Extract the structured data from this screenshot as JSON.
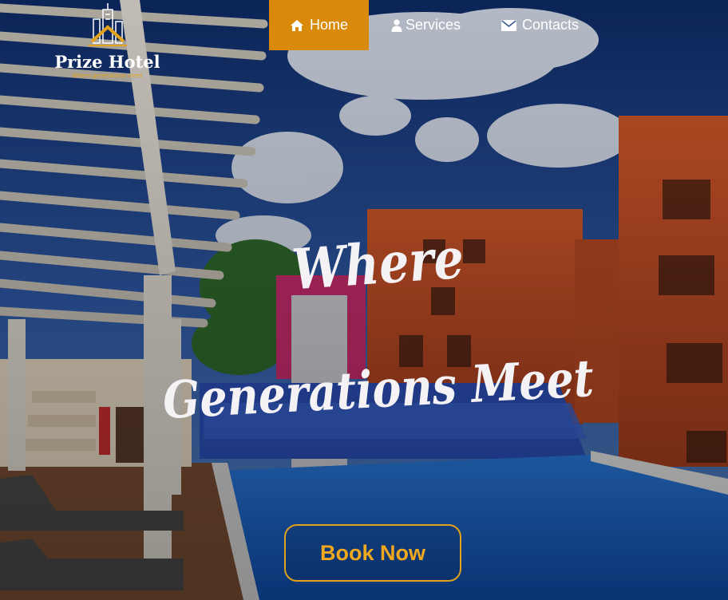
{
  "brand": {
    "name": "Prize Hotel",
    "tagline": "Where generations meet"
  },
  "nav": {
    "items": [
      {
        "label": "Home",
        "icon": "home-icon",
        "active": true
      },
      {
        "label": "Services",
        "icon": "user-icon",
        "active": false
      },
      {
        "label": "Contacts",
        "icon": "envelope-icon",
        "active": false
      }
    ]
  },
  "hero": {
    "line1": "Where",
    "line2": "Generations Meet"
  },
  "cta": {
    "label": "Book Now"
  },
  "colors": {
    "accent": "#d98a0b",
    "cta_text": "#f0a81f",
    "pool": "#1f6fd6",
    "building": "#c9532a"
  }
}
